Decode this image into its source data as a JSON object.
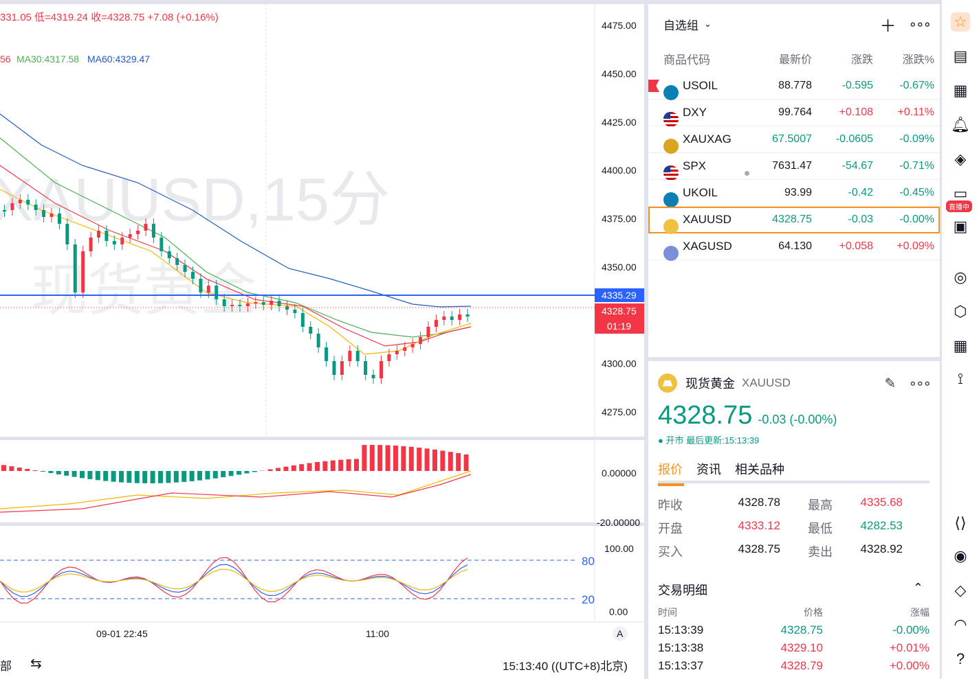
{
  "chart": {
    "header_ohlc": "331.05 低=4319.24 收=4328.75 +7.08 (+0.16%)",
    "ma_line_prefix": "56",
    "ma30": "MA30:4317.58",
    "ma60": "MA60:4329.47",
    "watermark_1": "XAUUSD,15分",
    "watermark_2": "现货黄金",
    "price_axis": [
      "4475.00",
      "4450.00",
      "4425.00",
      "4400.00",
      "4375.00",
      "4350.00",
      "4325.00",
      "4300.00",
      "4275.00"
    ],
    "price_line_label": "4335.29",
    "last_price_label": "4328.75",
    "countdown": "01:19",
    "macd_axis": [
      "0.00000",
      "-20.00000"
    ],
    "kdj_axis": [
      "100.00",
      "0.00"
    ],
    "kdj_levels": [
      "80",
      "20"
    ],
    "time_axis": [
      "09-01 22:45",
      "11:00"
    ],
    "auto_label": "A",
    "bottom_left": "部",
    "clock": "15:13:40 ((UTC+8)北京)",
    "colors": {
      "up": "#f23645",
      "down": "#089981",
      "ma60": "#1e5bc6",
      "ma30": "#4caf50",
      "price_line": "#2962ff"
    }
  },
  "watchlist": {
    "title": "自选组",
    "add_icon": "plus-icon",
    "more_icon": "more-icon",
    "columns": [
      "商品代码",
      "最新价",
      "涨跌",
      "涨跌%"
    ],
    "rows": [
      {
        "symbol": "USOIL",
        "last": "88.778",
        "chg": "-0.595",
        "pct": "-0.67%",
        "dir": "neg",
        "flag": true,
        "icon": "#0e7fb5"
      },
      {
        "symbol": "DXY",
        "last": "99.764",
        "chg": "+0.108",
        "pct": "+0.11%",
        "dir": "pos",
        "flag": false,
        "icon": "us-flag"
      },
      {
        "symbol": "XAUXAG",
        "last": "67.5007",
        "chg": "-0.0605",
        "pct": "-0.09%",
        "dir": "neg",
        "flag": false,
        "icon": "#d9a520",
        "last_color": "neg"
      },
      {
        "symbol": "SPX",
        "last": "7631.47",
        "chg": "-54.67",
        "pct": "-0.71%",
        "dir": "neg",
        "flag": false,
        "icon": "us-flag",
        "dot": true
      },
      {
        "symbol": "UKOIL",
        "last": "93.99",
        "chg": "-0.42",
        "pct": "-0.45%",
        "dir": "neg",
        "flag": false,
        "icon": "#0e7fb5"
      },
      {
        "symbol": "XAUUSD",
        "last": "4328.75",
        "chg": "-0.03",
        "pct": "-0.00%",
        "dir": "neg",
        "flag": false,
        "icon": "#f0c040",
        "selected": true,
        "last_color": "neg"
      },
      {
        "symbol": "XAGUSD",
        "last": "64.130",
        "chg": "+0.058",
        "pct": "+0.09%",
        "dir": "pos",
        "flag": false,
        "icon": "#7b8ed9"
      }
    ]
  },
  "details": {
    "name": "现货黄金",
    "symbol": "XAUUSD",
    "price": "4328.75",
    "change": "-0.03 (-0.00%)",
    "status": "● 开市 最后更新:15:13:39",
    "tabs": [
      "报价",
      "资讯",
      "相关品种"
    ],
    "quotes": [
      {
        "label": "昨收",
        "value": "4328.78",
        "label2": "最高",
        "value2": "4335.68",
        "c1": "",
        "c2": "pos"
      },
      {
        "label": "开盘",
        "value": "4333.12",
        "label2": "最低",
        "value2": "4282.53",
        "c1": "pos",
        "c2": "neg"
      },
      {
        "label": "买入",
        "value": "4328.75",
        "label2": "卖出",
        "value2": "4328.92",
        "c1": "",
        "c2": ""
      }
    ],
    "trades_title": "交易明细",
    "trade_cols": [
      "时间",
      "价格",
      "涨幅"
    ],
    "trades": [
      {
        "t": "15:13:39",
        "p": "4328.75",
        "c": "-0.00%",
        "pc": "neg",
        "cc": "neg"
      },
      {
        "t": "15:13:38",
        "p": "4329.10",
        "c": "+0.01%",
        "pc": "pos",
        "cc": "pos"
      },
      {
        "t": "15:13:37",
        "p": "4328.79",
        "c": "+0.00%",
        "pc": "pos",
        "cc": "pos"
      },
      {
        "t": "15:13:36",
        "p": "",
        "c": "",
        "pc": "",
        "cc": ""
      }
    ]
  },
  "toolbar": {
    "live_badge": "直播中",
    "icons": [
      "star-icon",
      "news-icon",
      "calendar-icon",
      "bell-icon",
      "layers-icon",
      "video-icon",
      "chat-icon",
      "target-icon",
      "box-icon",
      "grid-icon",
      "network-icon",
      "code-icon",
      "robot-icon",
      "diamond-icon",
      "headset-icon",
      "help-icon"
    ]
  }
}
